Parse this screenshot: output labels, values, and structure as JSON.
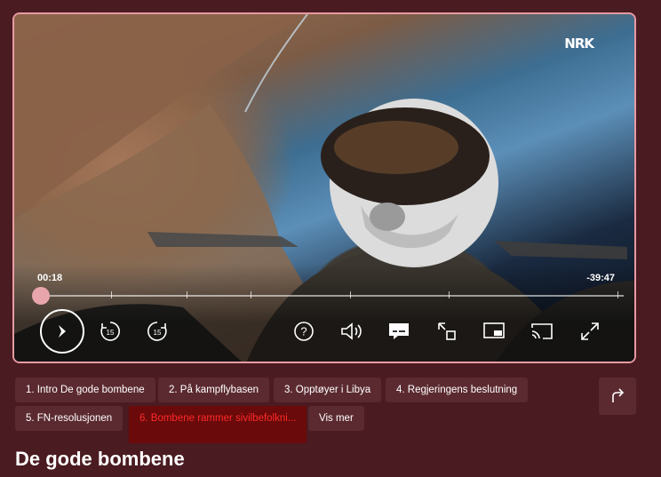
{
  "player": {
    "channel_logo": "NRK",
    "time_elapsed": "00:18",
    "time_remaining": "-39:47",
    "progress_fraction": 0.0075,
    "controls": [
      {
        "name": "play-button",
        "icon": "play-icon"
      },
      {
        "name": "rewind-15-button",
        "icon": "rewind-15-icon",
        "label": "15"
      },
      {
        "name": "forward-15-button",
        "icon": "forward-15-icon",
        "label": "15"
      },
      {
        "name": "help-button",
        "icon": "help-icon"
      },
      {
        "name": "volume-button",
        "icon": "volume-icon"
      },
      {
        "name": "subtitles-button",
        "icon": "subtitles-icon"
      },
      {
        "name": "resize-button",
        "icon": "resize-icon"
      },
      {
        "name": "pip-button",
        "icon": "picture-in-picture-icon"
      },
      {
        "name": "cast-button",
        "icon": "cast-icon"
      },
      {
        "name": "fullscreen-button",
        "icon": "fullscreen-icon"
      }
    ]
  },
  "chapters": [
    {
      "label": "1. Intro De gode bombene"
    },
    {
      "label": "2. På kampflybasen"
    },
    {
      "label": "3. Opptøyer i Libya"
    },
    {
      "label": "4. Regjeringens beslutning"
    },
    {
      "label": "5. FN-resolusjonen"
    },
    {
      "label": "6. Bombene rammer sivilbefolkni...",
      "active": true
    },
    {
      "label": "Vis mer"
    }
  ],
  "share": {
    "icon": "share-icon"
  },
  "page_title": "De gode bombene",
  "colors": {
    "background": "#4a1b21",
    "chip": "#5b2a30",
    "accent": "#e8a5ab",
    "active_chip_bg": "#6a0a0a",
    "active_chip_text": "#ff2a2a"
  }
}
